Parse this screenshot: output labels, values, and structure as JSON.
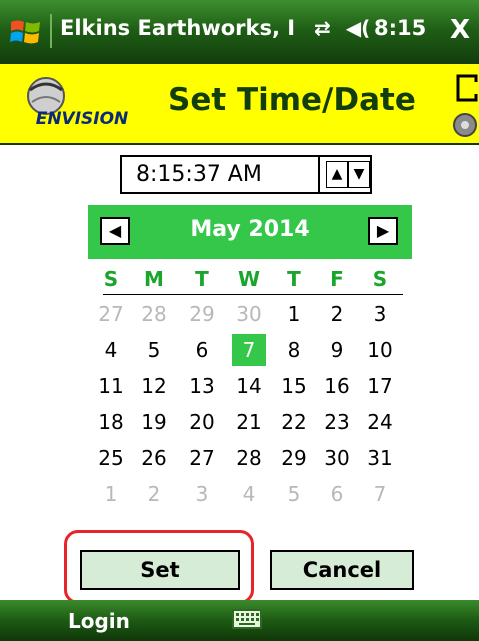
{
  "titlebar": {
    "app_title": "Elkins Earthworks, I",
    "time": "8:15",
    "close_label": "X"
  },
  "header": {
    "logo_text": "ENVISION",
    "title": "Set Time/Date"
  },
  "time_picker": {
    "value": "8:15:37 AM",
    "up_glyph": "▲",
    "down_glyph": "▼"
  },
  "calendar": {
    "month_label": "May 2014",
    "prev_glyph": "◀",
    "next_glyph": "▶",
    "weekdays": [
      "S",
      "M",
      "T",
      "W",
      "T",
      "F",
      "S"
    ],
    "selected_day": "7",
    "weeks": [
      [
        {
          "d": "27",
          "o": true
        },
        {
          "d": "28",
          "o": true
        },
        {
          "d": "29",
          "o": true
        },
        {
          "d": "30",
          "o": true
        },
        {
          "d": "1",
          "o": false
        },
        {
          "d": "2",
          "o": false
        },
        {
          "d": "3",
          "o": false
        }
      ],
      [
        {
          "d": "4",
          "o": false
        },
        {
          "d": "5",
          "o": false
        },
        {
          "d": "6",
          "o": false
        },
        {
          "d": "7",
          "o": false
        },
        {
          "d": "8",
          "o": false
        },
        {
          "d": "9",
          "o": false
        },
        {
          "d": "10",
          "o": false
        }
      ],
      [
        {
          "d": "11",
          "o": false
        },
        {
          "d": "12",
          "o": false
        },
        {
          "d": "13",
          "o": false
        },
        {
          "d": "14",
          "o": false
        },
        {
          "d": "15",
          "o": false
        },
        {
          "d": "16",
          "o": false
        },
        {
          "d": "17",
          "o": false
        }
      ],
      [
        {
          "d": "18",
          "o": false
        },
        {
          "d": "19",
          "o": false
        },
        {
          "d": "20",
          "o": false
        },
        {
          "d": "21",
          "o": false
        },
        {
          "d": "22",
          "o": false
        },
        {
          "d": "23",
          "o": false
        },
        {
          "d": "24",
          "o": false
        }
      ],
      [
        {
          "d": "25",
          "o": false
        },
        {
          "d": "26",
          "o": false
        },
        {
          "d": "27",
          "o": false
        },
        {
          "d": "28",
          "o": false
        },
        {
          "d": "29",
          "o": false
        },
        {
          "d": "30",
          "o": false
        },
        {
          "d": "31",
          "o": false
        }
      ],
      [
        {
          "d": "1",
          "o": true
        },
        {
          "d": "2",
          "o": true
        },
        {
          "d": "3",
          "o": true
        },
        {
          "d": "4",
          "o": true
        },
        {
          "d": "5",
          "o": true
        },
        {
          "d": "6",
          "o": true
        },
        {
          "d": "7",
          "o": true
        }
      ]
    ]
  },
  "actions": {
    "set_label": "Set",
    "cancel_label": "Cancel"
  },
  "softkeys": {
    "left_label": "Login",
    "keyboard_icon": "keyboard-icon"
  },
  "colors": {
    "titlebar_green": "#1f5f16",
    "header_yellow": "#ffff00",
    "calendar_green": "#35c74a",
    "weekday_green": "#1aa52d",
    "highlight_red": "#e8232a",
    "button_fill": "#d6ecd6"
  }
}
